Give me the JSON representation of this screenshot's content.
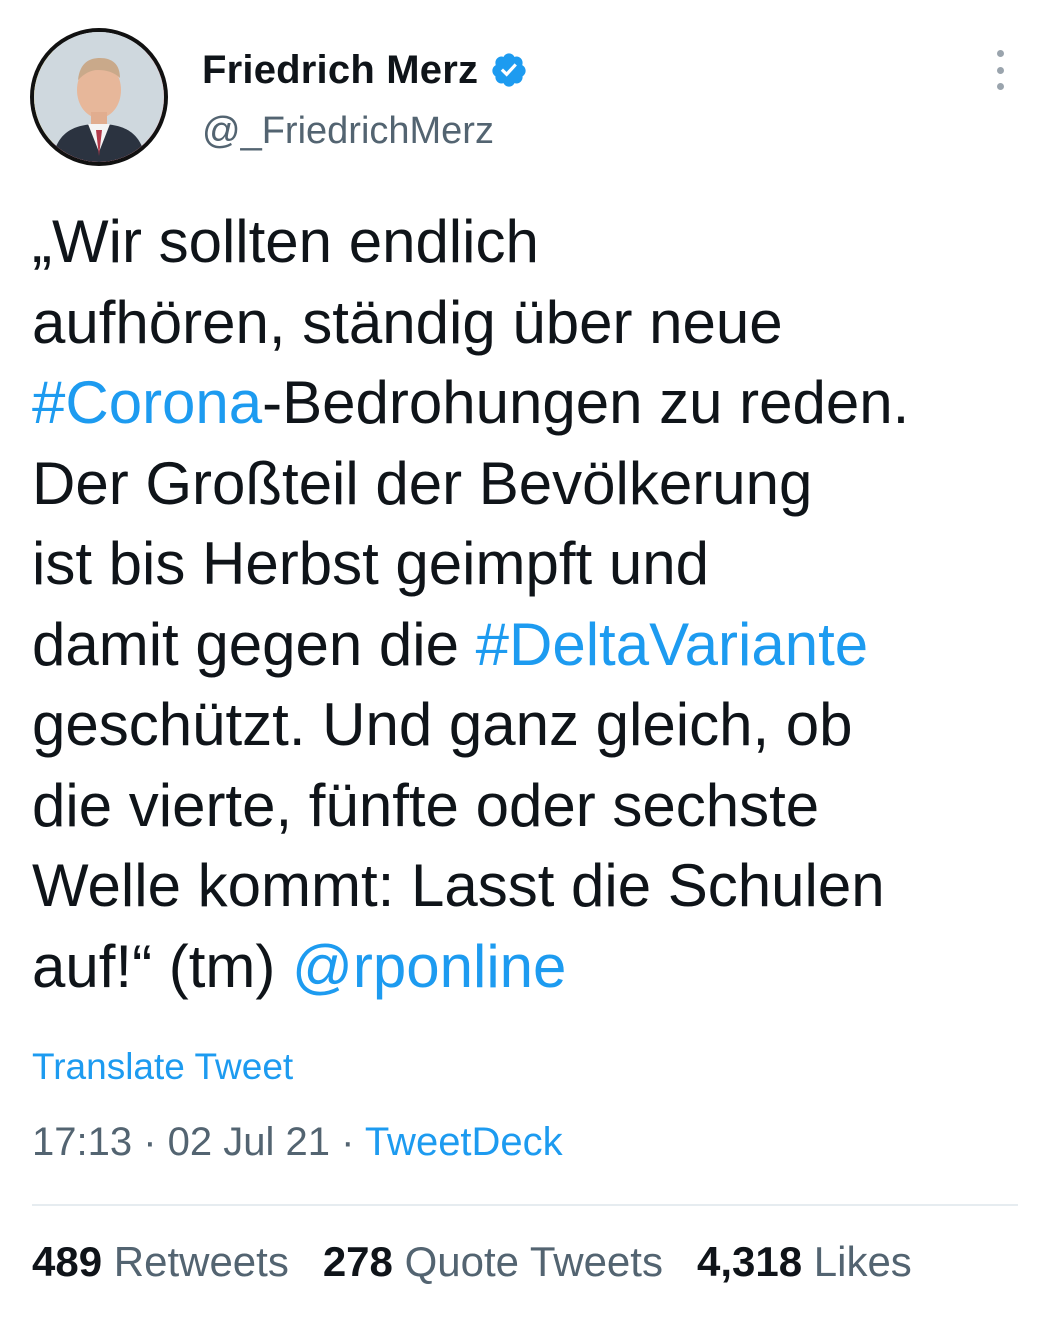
{
  "colors": {
    "link": "#1d9bf0",
    "text": "#0f1419",
    "muted": "#536471",
    "verified": "#1d9bf0"
  },
  "author": {
    "display_name": "Friedrich Merz",
    "handle": "@_FriedrichMerz",
    "verified": true
  },
  "tweet": {
    "lines": [
      [
        {
          "t": "„Wir sollten endlich"
        }
      ],
      [
        {
          "t": "aufhören, ständig über neue"
        }
      ],
      [
        {
          "t": "#Corona",
          "link": true
        },
        {
          "t": "-Bedrohungen zu reden."
        }
      ],
      [
        {
          "t": "Der Großteil der Bevölkerung"
        }
      ],
      [
        {
          "t": "ist bis Herbst geimpft und"
        }
      ],
      [
        {
          "t": "damit gegen die "
        },
        {
          "t": "#DeltaVariante",
          "link": true
        }
      ],
      [
        {
          "t": "geschützt. Und ganz gleich, ob"
        }
      ],
      [
        {
          "t": "die vierte, fünfte oder sechste"
        }
      ],
      [
        {
          "t": "Welle kommt: Lasst die Schulen"
        }
      ],
      [
        {
          "t": "auf!“ (tm) "
        },
        {
          "t": "@rponline",
          "link": true
        }
      ]
    ]
  },
  "translate_label": "Translate Tweet",
  "meta": {
    "time": "17:13",
    "separator": " · ",
    "date": "02 Jul 21",
    "source": "TweetDeck"
  },
  "stats": [
    {
      "num": "489",
      "label": "Retweets"
    },
    {
      "num": "278",
      "label": "Quote Tweets"
    },
    {
      "num": "4,318",
      "label": "Likes"
    }
  ],
  "icons": {
    "verified": "verified-badge-icon",
    "more": "more-vertical-icon"
  }
}
